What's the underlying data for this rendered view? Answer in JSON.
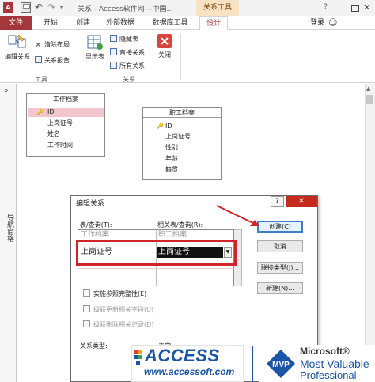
{
  "window": {
    "title": "关系 - Access软件网---中国...",
    "contextual_tab": "关系工具",
    "app_badge": "A",
    "login": "登录"
  },
  "tabs": [
    {
      "label": "文件"
    },
    {
      "label": "开始"
    },
    {
      "label": "创建"
    },
    {
      "label": "外部数据"
    },
    {
      "label": "数据库工具"
    },
    {
      "label": "设计"
    }
  ],
  "ribbon": {
    "edit_relationships": "编辑关系",
    "clear_layout": "清除布局",
    "relationship_report": "关系报告",
    "group_tools": "工具",
    "show_table": "显示表",
    "hide_table": "隐藏表",
    "direct_relationships": "直接关系",
    "all_relationships": "所有关系",
    "close": "关闭",
    "group_relationships": "关系"
  },
  "nav_pane": {
    "label": "导航窗格",
    "chevron": "»"
  },
  "tables": [
    {
      "title": "工作档案",
      "fields": [
        "ID",
        "上岗证号",
        "姓名",
        "工作时间"
      ],
      "key_field": "ID"
    },
    {
      "title": "职工档案",
      "fields": [
        "ID",
        "上岗证号",
        "性别",
        "年龄",
        "籍贯"
      ],
      "key_field": "ID"
    }
  ],
  "dialog": {
    "title": "编辑关系",
    "help": "?",
    "close": "✕",
    "table_query_label": "表/查询(T):",
    "related_table_label": "相关表/查询(R):",
    "table_value": "工作档案",
    "related_value": "职工档案",
    "field_left": "上岗证号",
    "field_right": "上岗证号",
    "enforce_integrity": "实施参照完整性(E)",
    "cascade_update": "级联更新相关字段(U)",
    "cascade_delete": "级联删除相关记录(D)",
    "relationship_type_label": "关系类型:",
    "relationship_type_value": "未定",
    "buttons": {
      "create": "创建(C)",
      "cancel": "取消",
      "join_type": "联接类型(J)...",
      "new": "新建(N)..."
    }
  },
  "watermark": {
    "access_title": "ACCESS",
    "access_url": "www.accessoft.com",
    "mvp_badge": "MVP",
    "mvp_company": "Microsoft®",
    "mvp_line1": "Most Valuable",
    "mvp_line2": "Professional"
  },
  "colors": {
    "accent": "#a4373a",
    "highlight_border": "#d1242a",
    "brand_blue": "#1b55a6"
  }
}
